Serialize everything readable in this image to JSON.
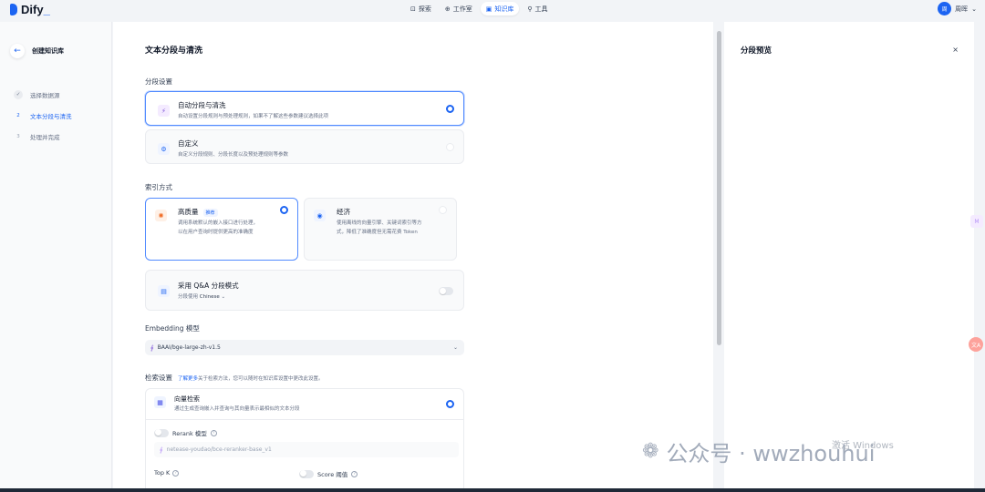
{
  "app": {
    "logo_text": "Dify",
    "logo_suffix": "_"
  },
  "nav": [
    {
      "icon": "⊡",
      "label": "探索",
      "active": false
    },
    {
      "icon": "⊕",
      "label": "工作室",
      "active": false
    },
    {
      "icon": "▣",
      "label": "知识库",
      "active": true
    },
    {
      "icon": "⚲",
      "label": "工具",
      "active": false
    }
  ],
  "user": {
    "avatar_text": "周",
    "name": "周晖",
    "caret": "⌄"
  },
  "sidebar": {
    "back_icon": "←",
    "title": "创建知识库",
    "steps": [
      {
        "num": "✓",
        "label": "选择数据源",
        "state": "done"
      },
      {
        "num": "2",
        "label": "文本分段与清洗",
        "state": "active"
      },
      {
        "num": "3",
        "label": "处理并完成",
        "state": "pending"
      }
    ]
  },
  "main": {
    "title": "文本分段与清洗",
    "segment_label": "分段设置",
    "auto": {
      "icon": "⚡",
      "title": "自动分段与清洗",
      "desc": "自动设置分段规则与预处理规则，如果不了解这些参数建议选择此项",
      "selected": true
    },
    "custom": {
      "icon": "⚙",
      "title": "自定义",
      "desc": "自定义分段规则、分段长度以及预处理规则等参数",
      "selected": false
    },
    "index_label": "索引方式",
    "high_quality": {
      "icon": "✺",
      "title": "高质量",
      "badge": "推荐",
      "desc1": "调用系统默认的嵌入接口进行处理，",
      "desc2": "以在用户查询时提供更高的准确度",
      "selected": true
    },
    "economy": {
      "icon": "◉",
      "title": "经济",
      "desc1": "使用离线的向量引擎、关键词索引等方",
      "desc2": "式，降低了准确度但无需花费 Token",
      "selected": false
    },
    "qa": {
      "icon": "▤",
      "title": "采用 Q&A 分段模式",
      "lang_prefix": "分段使用",
      "lang": "Chinese",
      "caret": "⌄"
    },
    "embedding_label": "Embedding 模型",
    "embedding_model": "BAAI/bge-large-zh-v1.5",
    "chevron": "⌄",
    "retrieval_label": "检索设置",
    "retrieval_link": "了解更多",
    "retrieval_desc": "关于检索方法，您可以随时在知识库设置中更改此设置。",
    "vector": {
      "icon": "▦",
      "title": "向量检索",
      "desc": "通过生成查询嵌入并查询与其向量表示最相似的文本分段",
      "selected": true
    },
    "rerank_label": "Rerank 模型",
    "rerank_model": "netease-youdao/bce-reranker-base_v1",
    "topk_label": "Top K",
    "score_label": "Score 阈值",
    "help_glyph": "?"
  },
  "preview": {
    "title": "分段预览",
    "close": "×"
  },
  "watermark": {
    "icon": "❁",
    "text": "公众号 · wwzhouhui"
  },
  "activate": {
    "text": "激活 Windows"
  },
  "float_icons": {
    "a": "M",
    "b": "文A"
  },
  "colors": {
    "accent": "#1c64f2",
    "border": "#eaecf0",
    "bg": "#f2f4f7"
  }
}
